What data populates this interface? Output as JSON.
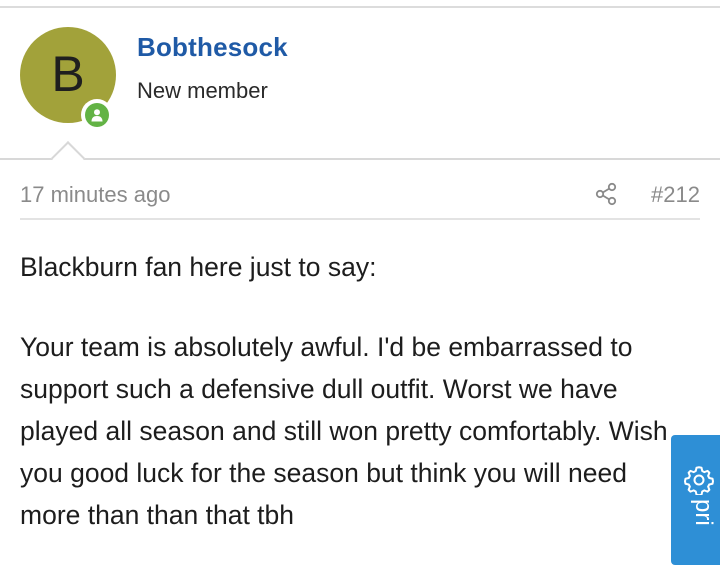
{
  "post": {
    "author": {
      "avatar_letter": "B",
      "avatar_color": "#a2a23a",
      "username": "Bobthesock",
      "title": "New member",
      "online_indicator_color": "#63b345"
    },
    "timestamp": "17 minutes ago",
    "share_icon": "share-icon",
    "post_number": "#212",
    "body": {
      "intro": "Blackburn fan here just to say:",
      "paragraph": "Your team is absolutely awful. I'd be embarrassed to support such a defensive dull outfit. Worst we have played all season and still won pretty comfortably. Wish you good luck for the season but think you will need more than than that tbh"
    }
  },
  "privacy_tab": {
    "label": "pri",
    "icon": "gear-icon",
    "color": "#2e8fd6"
  },
  "colors": {
    "username": "#1f5aa6",
    "meta_text": "#8a8a8a"
  }
}
